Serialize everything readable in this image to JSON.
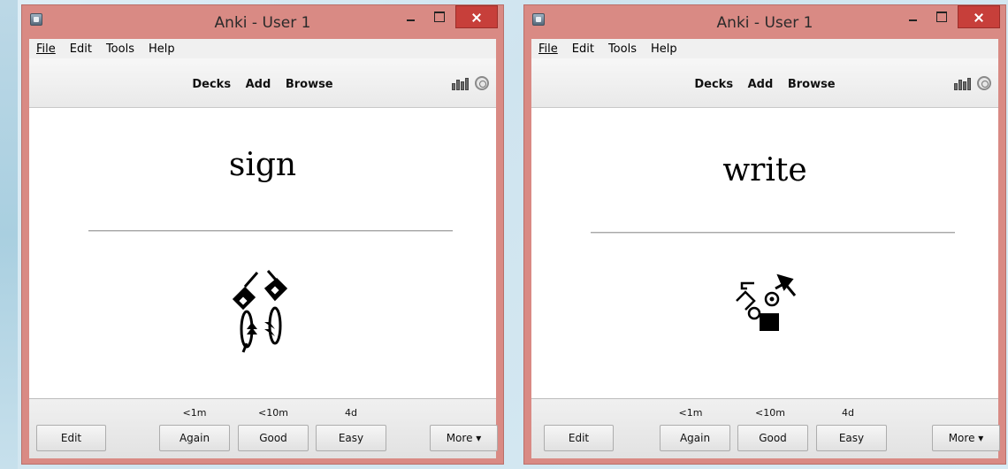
{
  "windows": [
    {
      "title": "Anki - User 1",
      "menu": [
        "File",
        "Edit",
        "Tools",
        "Help"
      ],
      "toolbar": [
        "Decks",
        "Add",
        "Browse"
      ],
      "card_word": "sign",
      "intervals": [
        "<1m",
        "<10m",
        "4d"
      ],
      "buttons": {
        "edit": "Edit",
        "again": "Again",
        "good": "Good",
        "easy": "Easy",
        "more": "More ▾"
      }
    },
    {
      "title": "Anki - User 1",
      "menu": [
        "File",
        "Edit",
        "Tools",
        "Help"
      ],
      "toolbar": [
        "Decks",
        "Add",
        "Browse"
      ],
      "card_word": "write",
      "intervals": [
        "<1m",
        "<10m",
        "4d"
      ],
      "buttons": {
        "edit": "Edit",
        "again": "Again",
        "good": "Good",
        "easy": "Easy",
        "more": "More ▾"
      }
    }
  ],
  "icons": {
    "app": "anki-app-icon",
    "stats": "stats-bars-icon",
    "sync": "sync-icon",
    "sign_symbol": "signwriting-sign-glyph",
    "write_symbol": "signwriting-write-glyph"
  },
  "colors": {
    "titlebar": "#d98a84",
    "close_button": "#c73f3a"
  }
}
